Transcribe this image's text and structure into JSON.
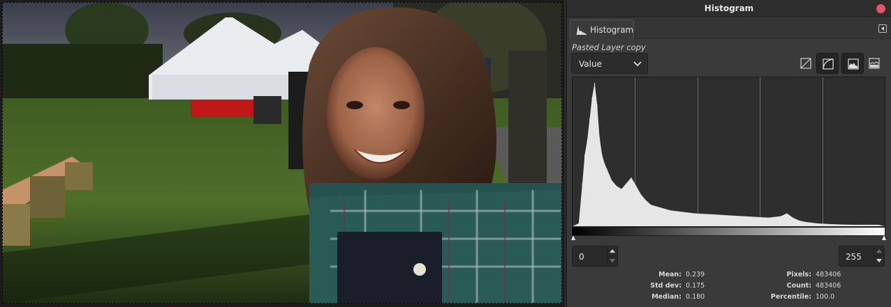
{
  "window": {
    "title": "Histogram"
  },
  "tab": {
    "label": "Histogram",
    "icon": "histogram-icon"
  },
  "layer": {
    "name": "Pasted Layer copy"
  },
  "channel": {
    "selected": "Value"
  },
  "scale_buttons": [
    {
      "name": "linear-histogram-icon",
      "active": false
    },
    {
      "name": "logarithmic-histogram-icon",
      "active": true
    },
    {
      "name": "histogram-bars-icon",
      "active": true
    },
    {
      "name": "histogram-outline-icon",
      "active": false
    }
  ],
  "range": {
    "low": "0",
    "high": "255"
  },
  "stats": {
    "mean_label": "Mean:",
    "mean": "0.239",
    "std_label": "Std dev:",
    "std": "0.175",
    "median_label": "Median:",
    "median": "0.180",
    "pixels_label": "Pixels:",
    "pixels": "483406",
    "count_label": "Count:",
    "count": "483406",
    "percentile_label": "Percentile:",
    "percentile": "100.0"
  },
  "colors": {
    "close": "#e2556d",
    "histogram_fill": "#e6e6e6"
  },
  "chart_data": {
    "type": "area",
    "x": [
      0,
      5,
      8,
      10,
      12,
      14,
      16,
      18,
      20,
      22,
      24,
      26,
      28,
      30,
      32,
      36,
      40,
      44,
      48,
      52,
      56,
      60,
      64,
      68,
      72,
      76,
      80,
      90,
      100,
      110,
      120,
      130,
      140,
      150,
      160,
      170,
      175,
      180,
      185,
      190,
      200,
      210,
      220,
      230,
      240,
      250,
      255
    ],
    "values": [
      0,
      0.02,
      0.3,
      0.5,
      0.6,
      0.75,
      0.9,
      1.0,
      0.85,
      0.62,
      0.5,
      0.44,
      0.4,
      0.36,
      0.32,
      0.28,
      0.26,
      0.3,
      0.34,
      0.28,
      0.22,
      0.18,
      0.15,
      0.14,
      0.13,
      0.12,
      0.11,
      0.1,
      0.09,
      0.085,
      0.08,
      0.075,
      0.07,
      0.065,
      0.06,
      0.07,
      0.09,
      0.06,
      0.04,
      0.03,
      0.02,
      0.015,
      0.012,
      0.01,
      0.01,
      0.01,
      0.0
    ],
    "xlim": [
      0,
      255
    ],
    "grid": true
  }
}
